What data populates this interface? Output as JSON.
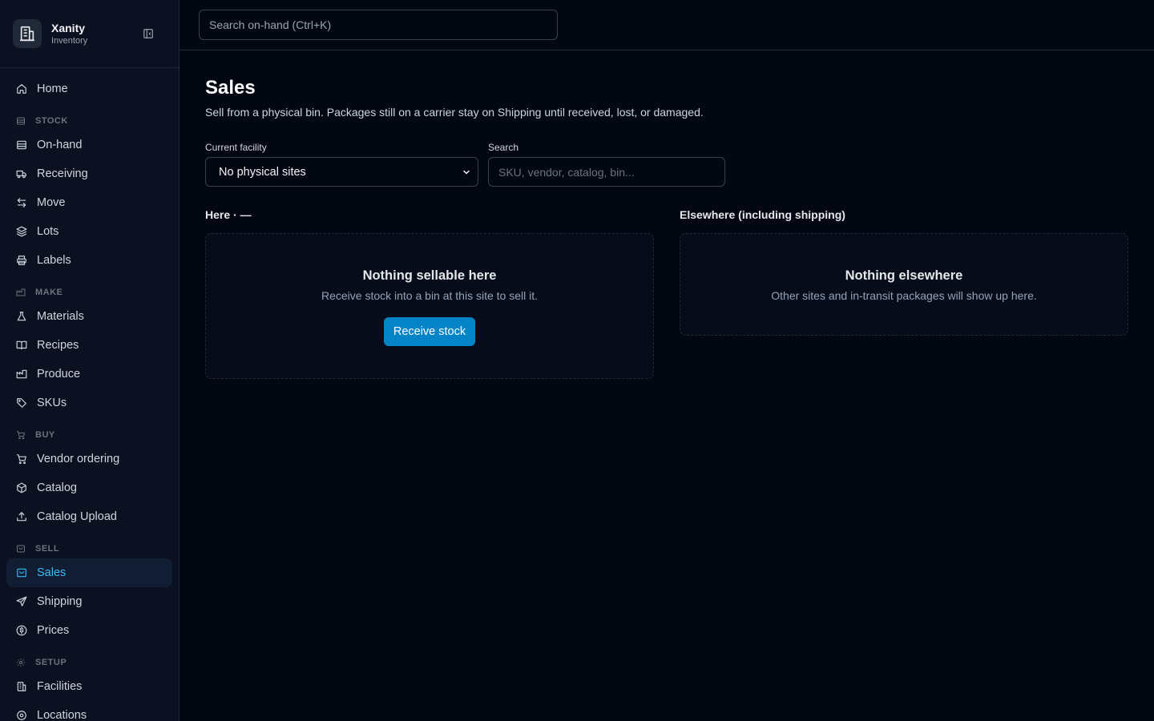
{
  "brand": {
    "name": "Xanity",
    "subtitle": "Inventory",
    "logo_icon": "building-icon",
    "collapse_icon": "sidebar-collapse-icon"
  },
  "sidebar": {
    "home": {
      "label": "Home",
      "icon": "home-icon"
    },
    "sections": [
      {
        "title": "STOCK",
        "icon": "archive-icon",
        "items": [
          {
            "label": "On-hand",
            "icon": "stack-icon"
          },
          {
            "label": "Receiving",
            "icon": "truck-icon"
          },
          {
            "label": "Move",
            "icon": "arrows-swap-icon"
          },
          {
            "label": "Lots",
            "icon": "layers-icon"
          },
          {
            "label": "Labels",
            "icon": "printer-icon"
          }
        ]
      },
      {
        "title": "MAKE",
        "icon": "factory-icon",
        "items": [
          {
            "label": "Materials",
            "icon": "flask-icon"
          },
          {
            "label": "Recipes",
            "icon": "book-open-icon"
          },
          {
            "label": "Produce",
            "icon": "factory-icon"
          },
          {
            "label": "SKUs",
            "icon": "tags-icon"
          }
        ]
      },
      {
        "title": "BUY",
        "icon": "cart-icon",
        "items": [
          {
            "label": "Vendor ordering",
            "icon": "cart-icon"
          },
          {
            "label": "Catalog",
            "icon": "package-icon"
          },
          {
            "label": "Catalog Upload",
            "icon": "upload-icon"
          }
        ]
      },
      {
        "title": "SELL",
        "icon": "shopping-bag-icon",
        "items": [
          {
            "label": "Sales",
            "icon": "shopping-bag-icon",
            "active": true
          },
          {
            "label": "Shipping",
            "icon": "send-icon"
          },
          {
            "label": "Prices",
            "icon": "dollar-circle-icon"
          }
        ]
      },
      {
        "title": "SETUP",
        "icon": "gear-icon",
        "items": [
          {
            "label": "Facilities",
            "icon": "building-icon"
          },
          {
            "label": "Locations",
            "icon": "map-pin-icon"
          }
        ]
      }
    ]
  },
  "topbar": {
    "search_placeholder": "Search on-hand (Ctrl+K)"
  },
  "page": {
    "title": "Sales",
    "description": "Sell from a physical bin. Packages still on a carrier stay on Shipping until received, lost, or damaged."
  },
  "filters": {
    "facility_label": "Current facility",
    "facility_value": "No physical sites",
    "search_label": "Search",
    "search_placeholder": "SKU, vendor, catalog, bin..."
  },
  "here": {
    "title": "Here · —",
    "empty_title": "Nothing sellable here",
    "empty_desc": "Receive stock into a bin at this site to sell it.",
    "button_label": "Receive stock"
  },
  "elsewhere": {
    "title": "Elsewhere (including shipping)",
    "empty_title": "Nothing elsewhere",
    "empty_desc": "Other sites and in-transit packages will show up here."
  },
  "colors": {
    "accent": "#0284c7",
    "active_text": "#38bdf8",
    "background": "#030712",
    "sidebar_bg": "#0b1120"
  }
}
